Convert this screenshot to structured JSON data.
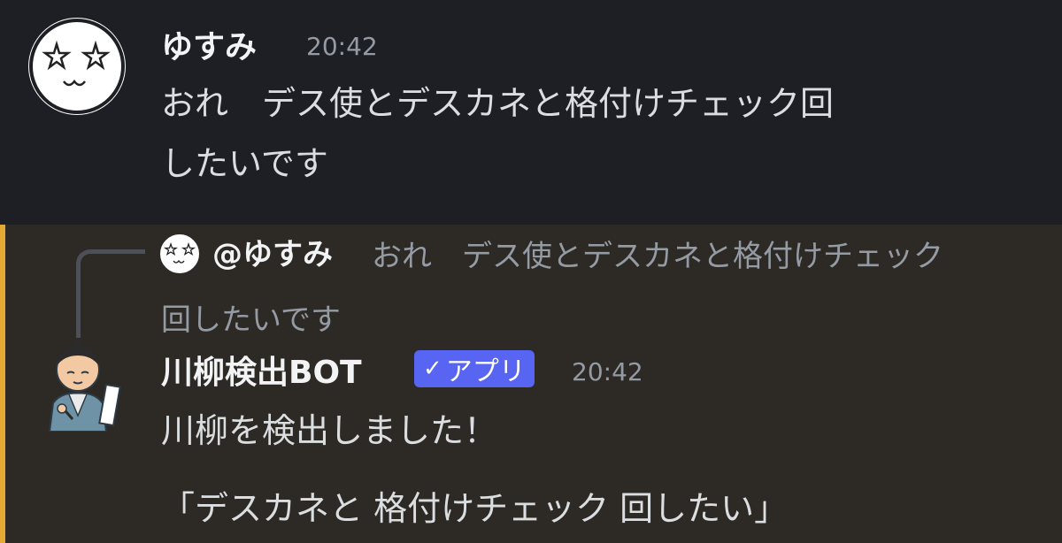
{
  "message1": {
    "author": "ゆすみ",
    "timestamp": "20:42",
    "lines": [
      "おれ　デス使とデスカネと格付けチェック回",
      "したいです"
    ]
  },
  "message2": {
    "reply": {
      "mention": "@ゆすみ",
      "text_line1": "おれ　デス使とデスカネと格付けチェック",
      "text_line2": "回したいです"
    },
    "author": "川柳検出BOT",
    "badge_label": "アプリ",
    "badge_icon": "checkmark-icon",
    "timestamp": "20:42",
    "lines": [
      "川柳を検出しました！",
      "「デスカネと 格付けチェック 回したい」"
    ]
  },
  "colors": {
    "background": "#1e1f24",
    "mention_background": "#2d2a25",
    "mention_bar": "#e4a932",
    "badge": "#5865f2"
  }
}
